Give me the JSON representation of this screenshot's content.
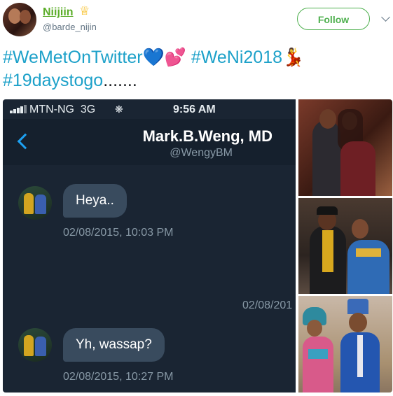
{
  "author": {
    "display_name": "Niijiin",
    "handle": "@barde_nijin",
    "crown_icon": "crown-icon"
  },
  "follow_label": "Follow",
  "tweet": {
    "tag1": "#WeMetOnTwitter",
    "tag2": "#WeNi2018",
    "tag3": "#19daystogo",
    "ellipsis": ".......",
    "emoji_blue_heart": "💙",
    "emoji_two_hearts": "💕",
    "emoji_dancer": "💃"
  },
  "phone": {
    "carrier": "MTN-NG",
    "network": "3G",
    "time": "9:56 AM",
    "contact_name": "Mark.B.Weng, MD",
    "contact_handle": "@WengyBM",
    "messages": [
      {
        "text": "Heya..",
        "timestamp": "02/08/2015, 10:03 PM"
      },
      {
        "text": "Yh, wassap?",
        "timestamp": "02/08/2015, 10:27 PM"
      }
    ],
    "partial_timestamp": "02/08/201"
  },
  "colors": {
    "accent_green": "#5cad2a",
    "hashtag_blue": "#1da1c9",
    "dm_background": "#1a2533",
    "bubble": "#394b5e"
  }
}
